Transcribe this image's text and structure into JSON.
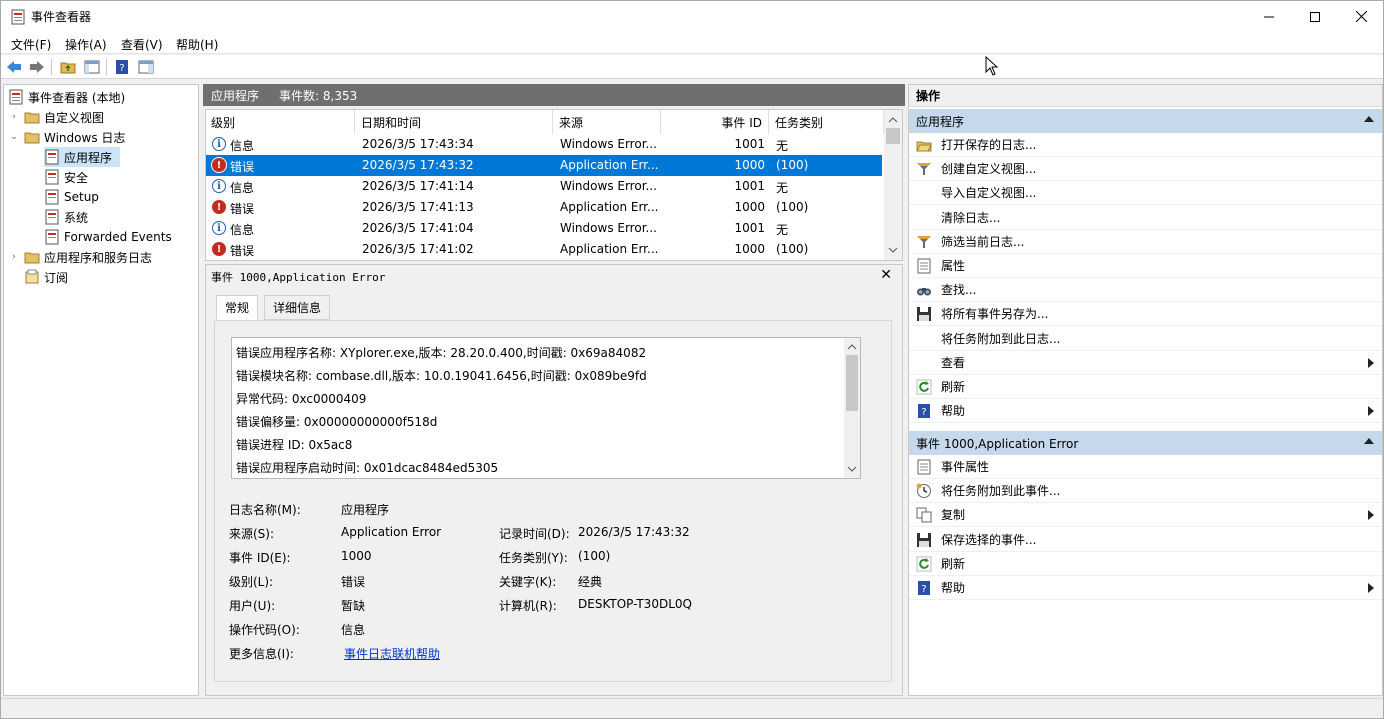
{
  "window": {
    "title": "事件查看器"
  },
  "menu": [
    "文件(F)",
    "操作(A)",
    "查看(V)",
    "帮助(H)"
  ],
  "tree": {
    "root": "事件查看器 (本地)",
    "custom_views": "自定义视图",
    "windows_logs": "Windows 日志",
    "logs": [
      "应用程序",
      "安全",
      "Setup",
      "系统",
      "Forwarded Events"
    ],
    "app_service_logs": "应用程序和服务日志",
    "subscriptions": "订阅"
  },
  "center": {
    "header_title": "应用程序",
    "header_count": "事件数: 8,353",
    "columns": [
      "级别",
      "日期和时间",
      "来源",
      "事件 ID",
      "任务类别"
    ],
    "rows": [
      {
        "level": "信息",
        "type": "info",
        "date": "2026/3/5 17:43:34",
        "source": "Windows Error...",
        "id": "1001",
        "task": "无"
      },
      {
        "level": "错误",
        "type": "error",
        "date": "2026/3/5 17:43:32",
        "source": "Application Err...",
        "id": "1000",
        "task": "(100)"
      },
      {
        "level": "信息",
        "type": "info",
        "date": "2026/3/5 17:41:14",
        "source": "Windows Error...",
        "id": "1001",
        "task": "无"
      },
      {
        "level": "错误",
        "type": "error",
        "date": "2026/3/5 17:41:13",
        "source": "Application Err...",
        "id": "1000",
        "task": "(100)"
      },
      {
        "level": "信息",
        "type": "info",
        "date": "2026/3/5 17:41:04",
        "source": "Windows Error...",
        "id": "1001",
        "task": "无"
      },
      {
        "level": "错误",
        "type": "error",
        "date": "2026/3/5 17:41:02",
        "source": "Application Err...",
        "id": "1000",
        "task": "(100)"
      }
    ],
    "selected_row": 1
  },
  "detail": {
    "title": "事件 1000,Application Error",
    "tabs": [
      "常规",
      "详细信息"
    ],
    "description": [
      "错误应用程序名称: XYplorer.exe,版本: 28.20.0.400,时间戳: 0x69a84082",
      "错误模块名称: combase.dll,版本: 10.0.19041.6456,时间戳: 0x089be9fd",
      "异常代码: 0xc0000409",
      "错误偏移量: 0x00000000000f518d",
      "错误进程 ID: 0x5ac8",
      "错误应用程序启动时间: 0x01dcac8484ed5305"
    ],
    "fields": {
      "log_name_label": "日志名称(M):",
      "log_name": "应用程序",
      "source_label": "来源(S):",
      "source": "Application Error",
      "logged_label": "记录时间(D):",
      "logged": "2026/3/5 17:43:32",
      "event_id_label": "事件 ID(E):",
      "event_id": "1000",
      "task_label": "任务类别(Y):",
      "task": "(100)",
      "level_label": "级别(L):",
      "level": "错误",
      "keywords_label": "关键字(K):",
      "keywords": "经典",
      "user_label": "用户(U):",
      "user": "暂缺",
      "computer_label": "计算机(R):",
      "computer": "DESKTOP-T30DL0Q",
      "opcode_label": "操作代码(O):",
      "opcode": "信息",
      "more_info_label": "更多信息(I):",
      "more_info": "事件日志联机帮助"
    }
  },
  "actions": {
    "header": "操作",
    "section1": "应用程序",
    "items1": [
      "打开保存的日志...",
      "创建自定义视图...",
      "导入自定义视图...",
      "清除日志...",
      "筛选当前日志...",
      "属性",
      "查找...",
      "将所有事件另存为...",
      "将任务附加到此日志...",
      "查看",
      "刷新",
      "帮助"
    ],
    "section2": "事件 1000,Application Error",
    "items2": [
      "事件属性",
      "将任务附加到此事件...",
      "复制",
      "保存选择的事件...",
      "刷新",
      "帮助"
    ]
  }
}
